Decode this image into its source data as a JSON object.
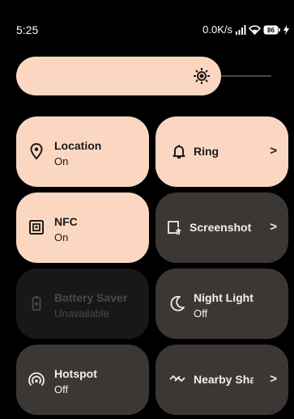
{
  "status_bar": {
    "time": "5:25",
    "net_speed": "0.0K/s",
    "battery": "86"
  },
  "brightness": {
    "level": 0.72
  },
  "tiles": [
    {
      "label": "Location",
      "sub": "On",
      "state": "on",
      "icon": "location-pin-icon"
    },
    {
      "label": "Ring",
      "sub": "",
      "state": "on",
      "icon": "bell-icon",
      "chevron": ">"
    },
    {
      "label": "NFC",
      "sub": "On",
      "state": "on",
      "icon": "nfc-icon"
    },
    {
      "label": "Screenshot",
      "sub": "",
      "state": "off",
      "icon": "screenshot-icon",
      "chevron": ">"
    },
    {
      "label": "Battery Saver",
      "sub": "Unavailable",
      "state": "disabled",
      "icon": "battery-saver-icon"
    },
    {
      "label": "Night Light",
      "sub": "Off",
      "state": "off",
      "icon": "moon-icon"
    },
    {
      "label": "Hotspot",
      "sub": "Off",
      "state": "off",
      "icon": "hotspot-icon"
    },
    {
      "label": "Nearby Share",
      "sub": "",
      "state": "off",
      "icon": "nearby-share-icon",
      "chevron": ">"
    }
  ],
  "colors": {
    "tile_on": "#fbd7c2",
    "tile_off": "#3b3735",
    "tile_disabled": "#1a1817"
  }
}
